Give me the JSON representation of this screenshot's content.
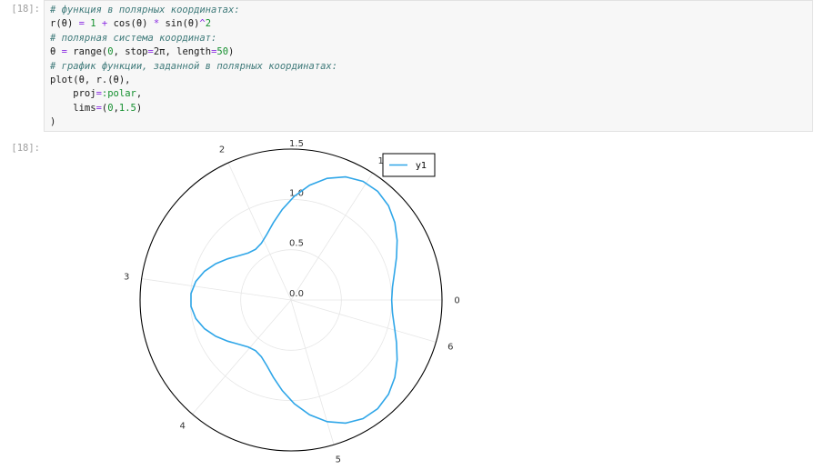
{
  "input_prompt": "[18]:",
  "output_prompt": "[18]:",
  "code": [
    [
      {
        "t": "# функция в полярных координатах:",
        "c": "cm"
      }
    ],
    [
      {
        "t": "r(θ) ",
        "c": ""
      },
      {
        "t": "=",
        "c": "op"
      },
      {
        "t": " ",
        "c": ""
      },
      {
        "t": "1",
        "c": "nm"
      },
      {
        "t": " ",
        "c": ""
      },
      {
        "t": "+",
        "c": "op"
      },
      {
        "t": " cos(θ) ",
        "c": ""
      },
      {
        "t": "*",
        "c": "op"
      },
      {
        "t": " sin(θ)",
        "c": ""
      },
      {
        "t": "^",
        "c": "op"
      },
      {
        "t": "2",
        "c": "nm"
      }
    ],
    [
      {
        "t": "# полярная система координат:",
        "c": "cm"
      }
    ],
    [
      {
        "t": "θ ",
        "c": ""
      },
      {
        "t": "=",
        "c": "op"
      },
      {
        "t": " range(",
        "c": ""
      },
      {
        "t": "0",
        "c": "nm"
      },
      {
        "t": ", stop",
        "c": ""
      },
      {
        "t": "=",
        "c": "op"
      },
      {
        "t": "2π, length",
        "c": ""
      },
      {
        "t": "=",
        "c": "op"
      },
      {
        "t": "50",
        "c": "nm"
      },
      {
        "t": ")",
        "c": ""
      }
    ],
    [
      {
        "t": "# график функции, заданной в полярных координатах:",
        "c": "cm"
      }
    ],
    [
      {
        "t": "plot(θ, r.(θ),",
        "c": ""
      }
    ],
    [
      {
        "t": "    proj",
        "c": ""
      },
      {
        "t": "=",
        "c": "op"
      },
      {
        "t": ":polar",
        "c": "sym"
      },
      {
        "t": ",",
        "c": ""
      }
    ],
    [
      {
        "t": "    lims",
        "c": ""
      },
      {
        "t": "=",
        "c": "op"
      },
      {
        "t": "(",
        "c": ""
      },
      {
        "t": "0",
        "c": "nm"
      },
      {
        "t": ",",
        "c": ""
      },
      {
        "t": "1.5",
        "c": "nm"
      },
      {
        "t": ")",
        "c": ""
      }
    ],
    [
      {
        "t": ")",
        "c": ""
      }
    ]
  ],
  "chart_data": {
    "type": "line",
    "projection": "polar",
    "function": "r(θ) = 1 + cos(θ) * sin(θ)^2",
    "theta_range": [
      0,
      6.283185307179586
    ],
    "theta_count": 50,
    "r_range": [
      0,
      1.5
    ],
    "radial_tick_labels": [
      "0.0",
      "0.5",
      "1.0",
      "1.5"
    ],
    "radial_tick_values": [
      0,
      0.5,
      1.0,
      1.5
    ],
    "angular_tick_labels": [
      "0",
      "1",
      "2",
      "3",
      "4",
      "5",
      "6"
    ],
    "angular_tick_values": [
      0,
      1,
      2,
      3,
      4,
      5,
      6
    ],
    "series": [
      {
        "name": "y1",
        "color": "#2fa6e8"
      }
    ],
    "legend_position": "top-right",
    "grid": true
  }
}
